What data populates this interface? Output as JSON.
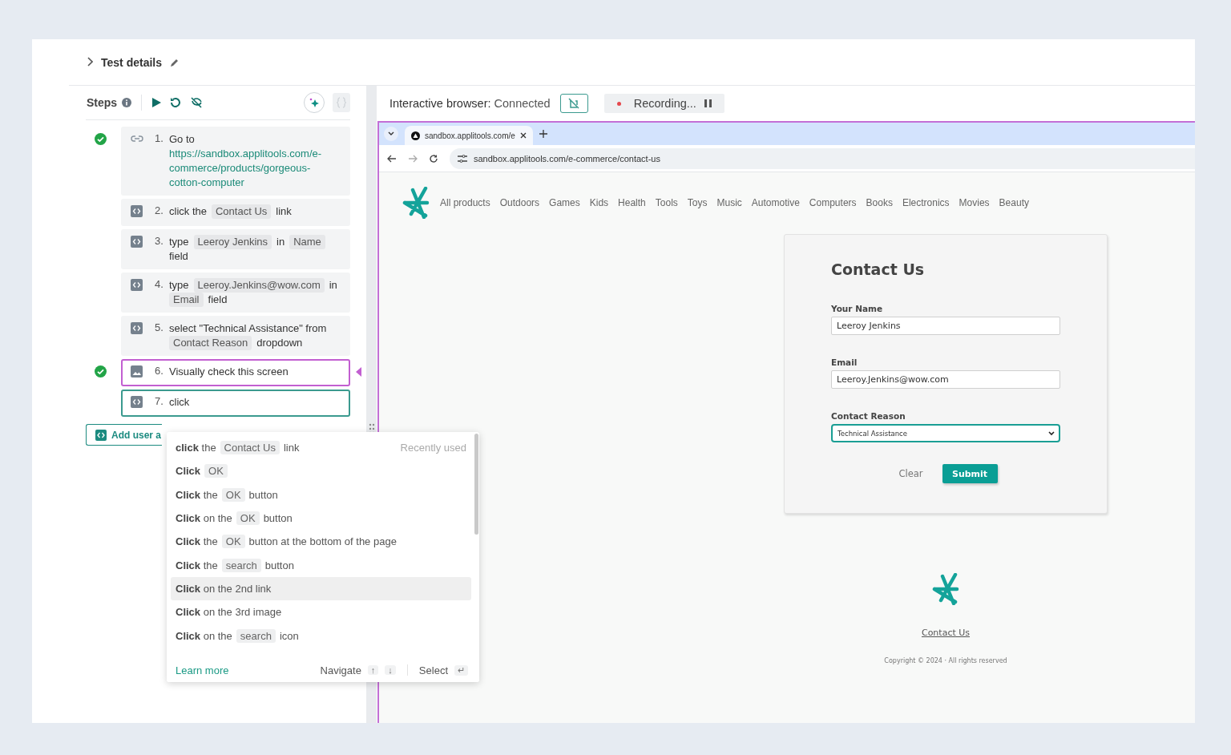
{
  "header": {
    "title": "Test details"
  },
  "steps_panel": {
    "title": "Steps",
    "add_button": "Add user a",
    "steps": [
      {
        "number": "1.",
        "kind": "link",
        "passed": true,
        "selected": false,
        "editing": false,
        "parts": [
          {
            "kind": "text",
            "text": "Go to"
          },
          {
            "kind": "link",
            "text": "https://sandbox.applitools.com/e-commerce/products/gorgeous-cotton-computer"
          }
        ]
      },
      {
        "number": "2.",
        "kind": "code",
        "passed": false,
        "selected": false,
        "editing": false,
        "parts": [
          {
            "kind": "text",
            "text": "click the"
          },
          {
            "kind": "chip",
            "text": "Contact Us"
          },
          {
            "kind": "text",
            "text": "link"
          }
        ]
      },
      {
        "number": "3.",
        "kind": "code",
        "passed": false,
        "selected": false,
        "editing": false,
        "parts": [
          {
            "kind": "text",
            "text": "type"
          },
          {
            "kind": "chip",
            "text": "Leeroy Jenkins"
          },
          {
            "kind": "text",
            "text": "in"
          },
          {
            "kind": "chip",
            "text": "Name"
          },
          {
            "kind": "text",
            "text": "field"
          }
        ]
      },
      {
        "number": "4.",
        "kind": "code",
        "passed": false,
        "selected": false,
        "editing": false,
        "parts": [
          {
            "kind": "text",
            "text": "type"
          },
          {
            "kind": "chip",
            "text": "Leeroy.Jenkins@wow.com"
          },
          {
            "kind": "text",
            "text": "in"
          },
          {
            "kind": "chip",
            "text": "Email"
          },
          {
            "kind": "text",
            "text": "field"
          }
        ]
      },
      {
        "number": "5.",
        "kind": "code",
        "passed": false,
        "selected": false,
        "editing": false,
        "parts": [
          {
            "kind": "text",
            "text": "select \"Technical Assistance\" from"
          },
          {
            "kind": "chip",
            "text": "Contact Reason"
          },
          {
            "kind": "text",
            "text": "dropdown"
          }
        ]
      },
      {
        "number": "6.",
        "kind": "image",
        "passed": true,
        "selected": true,
        "editing": false,
        "parts": [
          {
            "kind": "text",
            "text": "Visually check this screen"
          }
        ]
      },
      {
        "number": "7.",
        "kind": "code",
        "passed": false,
        "selected": false,
        "editing": true,
        "parts": [
          {
            "kind": "text",
            "text": "click"
          }
        ]
      }
    ]
  },
  "browser_bar": {
    "label": "Interactive browser:",
    "status": "Connected",
    "recording": "Recording..."
  },
  "browser": {
    "tab_title": "sandbox.applitools.com/e",
    "url": "sandbox.applitools.com/e-commerce/contact-us",
    "nav": [
      "All products",
      "Outdoors",
      "Games",
      "Kids",
      "Health",
      "Tools",
      "Toys",
      "Music",
      "Automotive",
      "Computers",
      "Books",
      "Electronics",
      "Movies",
      "Beauty"
    ],
    "form": {
      "title": "Contact Us",
      "fields": [
        {
          "kind": "text",
          "label": "Your Name",
          "value": "Leeroy Jenkins",
          "focused": false
        },
        {
          "kind": "text",
          "label": "Email",
          "value": "Leeroy.Jenkins@wow.com",
          "focused": false
        },
        {
          "kind": "select",
          "label": "Contact Reason",
          "value": "Technical Assistance",
          "focused": true
        }
      ],
      "clear": "Clear",
      "submit": "Submit"
    },
    "footer_link": "Contact Us",
    "copyright": "Copyright © 2024 · All rights reserved"
  },
  "suggestions": {
    "items": [
      {
        "selected": false,
        "hint": "Recently used",
        "parts": [
          {
            "kind": "text",
            "text": "**click** the"
          },
          {
            "kind": "chip",
            "text": "Contact Us"
          },
          {
            "kind": "text",
            "text": "link"
          }
        ]
      },
      {
        "selected": false,
        "parts": [
          {
            "kind": "text",
            "text": "**Click**"
          },
          {
            "kind": "chip",
            "text": "OK"
          }
        ]
      },
      {
        "selected": false,
        "parts": [
          {
            "kind": "text",
            "text": "**Click** the"
          },
          {
            "kind": "chip",
            "text": "OK"
          },
          {
            "kind": "text",
            "text": "button"
          }
        ]
      },
      {
        "selected": false,
        "parts": [
          {
            "kind": "text",
            "text": "**Click** on the"
          },
          {
            "kind": "chip",
            "text": "OK"
          },
          {
            "kind": "text",
            "text": "button"
          }
        ]
      },
      {
        "selected": false,
        "parts": [
          {
            "kind": "text",
            "text": "**Click** the"
          },
          {
            "kind": "chip",
            "text": "OK"
          },
          {
            "kind": "text",
            "text": "button at the bottom of the page"
          }
        ]
      },
      {
        "selected": false,
        "parts": [
          {
            "kind": "text",
            "text": "**Click** the"
          },
          {
            "kind": "chip",
            "text": "search"
          },
          {
            "kind": "text",
            "text": "button"
          }
        ]
      },
      {
        "selected": true,
        "parts": [
          {
            "kind": "text",
            "text": "**Click** on the 2nd link"
          }
        ]
      },
      {
        "selected": false,
        "parts": [
          {
            "kind": "text",
            "text": "**Click** on the 3rd image"
          }
        ]
      },
      {
        "selected": false,
        "parts": [
          {
            "kind": "text",
            "text": "**Click** on the"
          },
          {
            "kind": "chip",
            "text": "search"
          },
          {
            "kind": "text",
            "text": "icon"
          }
        ]
      }
    ],
    "learn_more": "Learn more",
    "navigate": "Navigate",
    "up": "↑",
    "down": "↓",
    "select": "Select",
    "enter": "↵"
  }
}
